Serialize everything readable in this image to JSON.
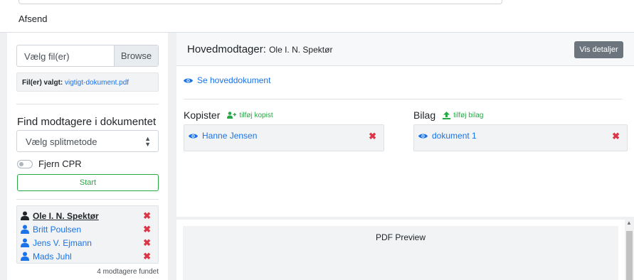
{
  "header": {
    "tab_label": "Afsend"
  },
  "left": {
    "file_placeholder": "Vælg fil(er)",
    "browse_label": "Browse",
    "chosen_label": "Fil(er) valgt:",
    "chosen_file": "vigtigt-dokument.pdf",
    "find_title": "Find modtagere i dokumentet",
    "split_method": "Vælg splitmetode",
    "remove_cpr_label": "Fjern CPR",
    "start_label": "Start",
    "recipients": [
      {
        "name": "Ole I. N. Spektør",
        "main": true
      },
      {
        "name": "Britt Poulsen",
        "main": false
      },
      {
        "name": "Jens V. Ejmann",
        "main": false
      },
      {
        "name": "Mads Juhl",
        "main": false
      }
    ],
    "found_text": "4 modtagere fundet"
  },
  "main": {
    "primary_label": "Hovedmodtager:",
    "primary_name": "Ole I. N. Spektør",
    "details_button": "Vis detaljer",
    "see_main_doc": "Se hoveddokument",
    "copies_title": "Kopister",
    "add_copy": "tilføj kopist",
    "copy_item": "Hanne Jensen",
    "attachments_title": "Bilag",
    "add_attachment": "tilføj bilag",
    "attachment_item": "dokument 1"
  },
  "preview": {
    "title": "PDF Preview"
  },
  "colors": {
    "link": "#1a73e8",
    "success": "#28a745",
    "danger": "#dc3545",
    "secondary": "#6c757d"
  }
}
